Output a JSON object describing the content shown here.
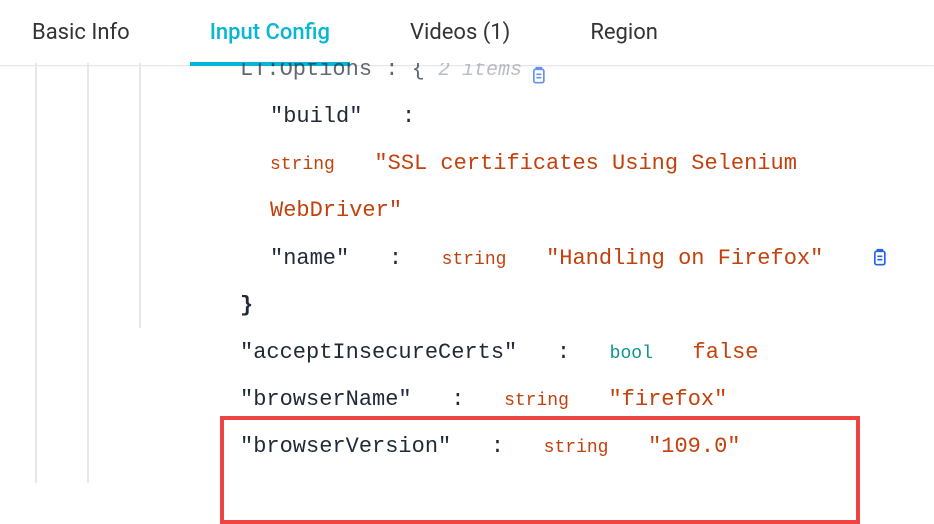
{
  "tabs": {
    "basic_info": "Basic Info",
    "input_config": "Input Config",
    "videos": "Videos (1)",
    "region": "Region"
  },
  "json": {
    "lt_options_key": "LT:Options",
    "lt_options_meta": "2 items",
    "build_key": "\"build\"",
    "build_type": "string",
    "build_value": "\"SSL certificates Using Selenium WebDriver\"",
    "name_key": "\"name\"",
    "name_type": "string",
    "name_value": "\"Handling on Firefox\"",
    "close_brace": "}",
    "accept_key": "\"acceptInsecureCerts\"",
    "accept_type": "bool",
    "accept_value": "false",
    "browser_name_key": "\"browserName\"",
    "browser_name_type": "string",
    "browser_name_value": "\"firefox\"",
    "browser_version_key": "\"browserVersion\"",
    "browser_version_type": "string",
    "browser_version_value": "\"109.0\"",
    "colon": ":",
    "open_brace": "{"
  }
}
